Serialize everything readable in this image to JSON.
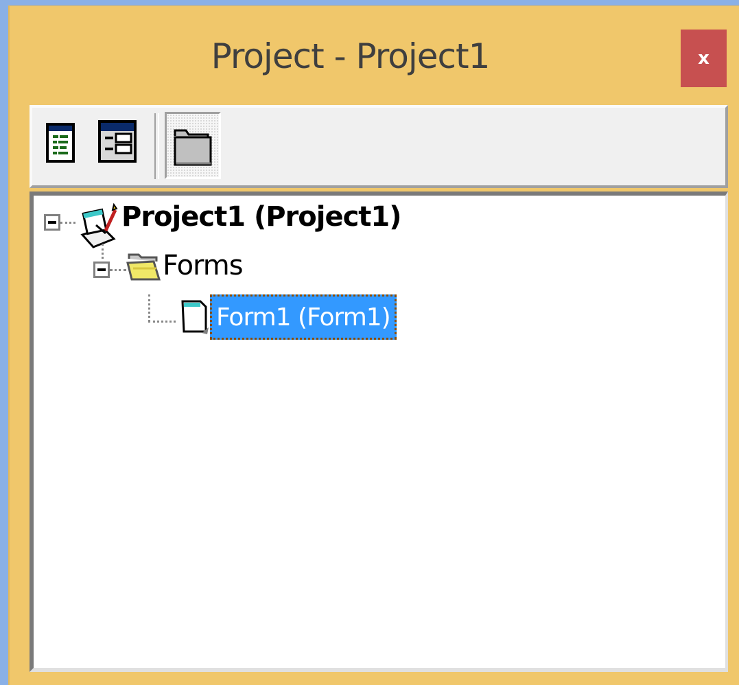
{
  "window": {
    "title": "Project - Project1",
    "close_label": "x",
    "accent_color": "#f0c76b",
    "close_color": "#c75050"
  },
  "toolbar": {
    "buttons": [
      {
        "name": "view-code-button",
        "icon": "view-code-icon"
      },
      {
        "name": "view-object-button",
        "icon": "view-object-icon"
      },
      {
        "name": "toggle-folders-button",
        "icon": "folder-icon",
        "pressed": true
      }
    ]
  },
  "tree": {
    "project": {
      "label": "Project1 (Project1)",
      "icon": "project-icon",
      "expanded": true
    },
    "forms_folder": {
      "label": "Forms",
      "icon": "open-folder-icon",
      "expanded": true
    },
    "form": {
      "label": "Form1 (Form1)",
      "icon": "form-icon",
      "selected": true,
      "selection_color": "#3399ff"
    }
  }
}
